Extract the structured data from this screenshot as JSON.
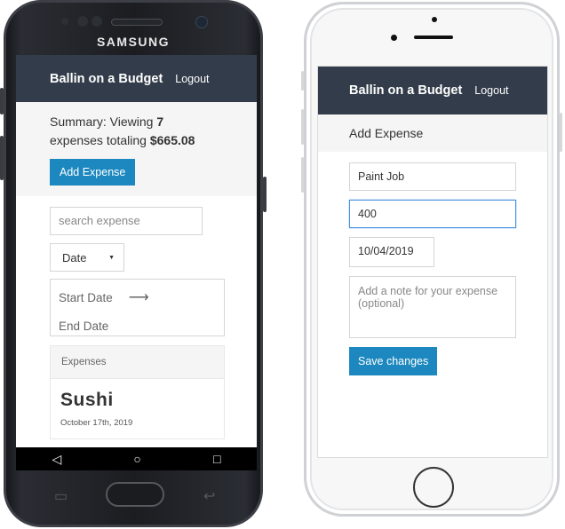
{
  "devices": {
    "samsung": {
      "brand": "SAMSUNG",
      "app": {
        "title": "Ballin on a Budget",
        "logout": "Logout",
        "summary": {
          "prefix": "Summary: Viewing",
          "count": "7",
          "middle": "expenses totaling",
          "total": "$665.08"
        },
        "add_expense_label": "Add Expense",
        "search_placeholder": "search expense",
        "sort_select": "Date",
        "start_date_placeholder": "Start Date",
        "end_date_placeholder": "End Date",
        "expenses_header": "Expenses",
        "expenses": [
          {
            "name": "Sushi",
            "date": "October 17th, 2019"
          }
        ]
      },
      "nav": {
        "back": "◁",
        "home": "○",
        "recents": "□"
      }
    },
    "iphone": {
      "app": {
        "title": "Ballin on a Budget",
        "logout": "Logout",
        "page_title": "Add Expense",
        "form": {
          "description": "Paint Job",
          "amount": "400",
          "date": "10/04/2019",
          "note_placeholder": "Add a note for your expense (optional)",
          "save_label": "Save changes"
        }
      }
    }
  },
  "colors": {
    "header_bg": "#333c4a",
    "button_bg": "#1c88bf",
    "panel_bg": "#f5f5f5",
    "focus_border": "#4a90e2"
  }
}
